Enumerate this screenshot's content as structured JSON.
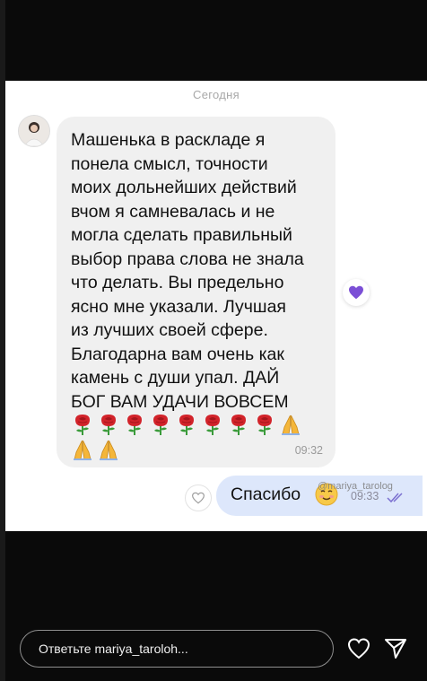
{
  "chat": {
    "date_separator": "Сегодня",
    "incoming": {
      "text": "Машенька в раскладе я\nпонела смысл, точности\nмоих дольнейших действий\nвчом я самневалась и не\nмогла сделать правильный\nвыбор права слова не знала\nчто делать. Вы предельно\nясно мне указали. Лучшая\nиз лучших своей сфере.\nБлагодарна вам очень как\nкамень с души упал. ДАЙ\nБОГ ВАМ УДАЧИ ВОВСЕМ",
      "emoji_rows": [
        [
          "rose",
          "rose",
          "rose",
          "rose",
          "rose",
          "rose",
          "rose",
          "rose",
          "pray"
        ],
        [
          "pray",
          "pray"
        ]
      ],
      "time": "09:32",
      "reaction": "purple-heart-icon"
    },
    "outgoing": {
      "text": "Спасибо",
      "emoji": "smiling-face-icon",
      "time": "09:33",
      "status": "read-double-check-icon"
    },
    "watermark": "@mariya_tarolog"
  },
  "reply": {
    "placeholder": "Ответьте mariya_taroloh..."
  },
  "colors": {
    "incoming_bubble": "#f0f0f0",
    "outgoing_bubble": "#dde7fb",
    "reaction_heart": "#7b4fd6",
    "background": "#0a0a0a"
  }
}
